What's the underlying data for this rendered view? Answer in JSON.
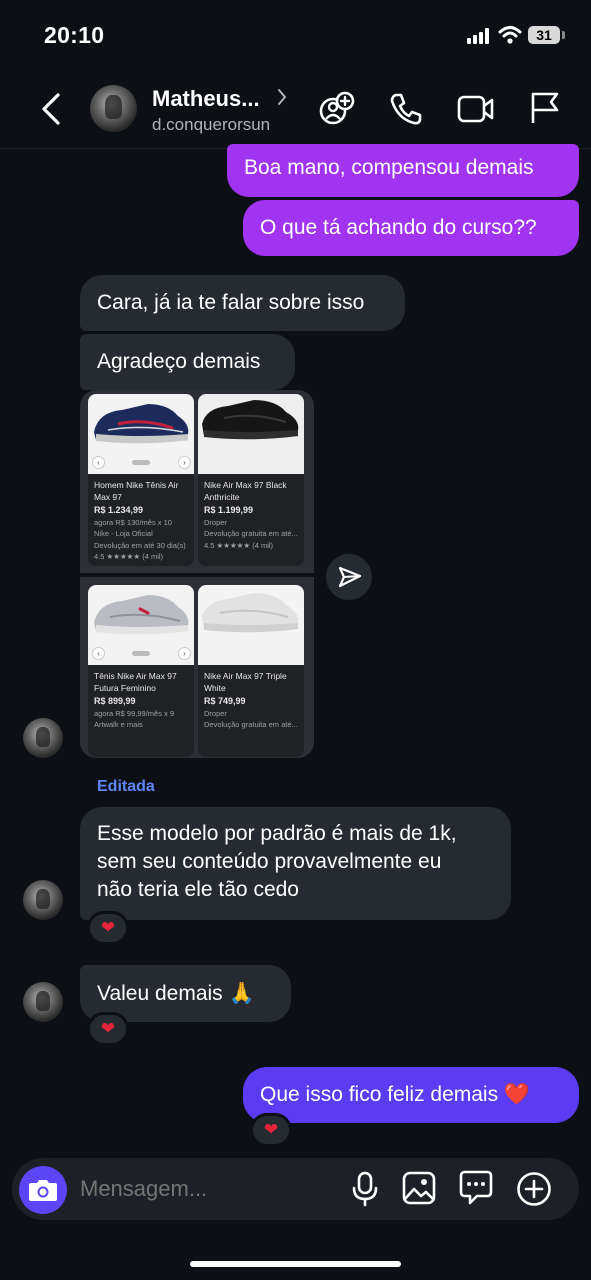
{
  "status_bar": {
    "time": "20:10",
    "battery": "31"
  },
  "header": {
    "contact_name": "Matheus...",
    "username": "d.conquerorsun"
  },
  "messages": {
    "out_1": "Boa mano, compensou demais",
    "out_2": "O que tá achando do curso??",
    "in_1": "Cara, já ia te falar sobre isso",
    "in_2": "Agradeço demais",
    "edited_label": "Editada",
    "in_3_line1": "Esse modelo por padrão é mais de 1k,",
    "in_3_line2": "sem seu conteúdo provavelmente eu",
    "in_3_line3": "não teria ele tão cedo",
    "in_4": "Valeu demais 🙏",
    "out_3": "Que isso fico feliz demais ❤️",
    "reaction": "❤"
  },
  "products": [
    {
      "title": "Homem Nike Tênis Air Max 97",
      "price": "R$ 1.234,99",
      "sub1": "agora R$ 130/mês x 10",
      "sub2": "Nike - Loja Oficial",
      "sub3": "Devolução em até 30 dia(s)",
      "rating": "4.5 ★★★★★ (4 mil)"
    },
    {
      "title": "Nike Air Max 97 Black Anthricite",
      "price": "R$ 1.199,99",
      "sub1": "Droper",
      "sub2": "Devolução gratuita em até...",
      "rating": "4.5 ★★★★★ (4 mil)"
    },
    {
      "title": "Tênis Nike Air Max 97 Futura Feminino",
      "price": "R$ 899,99",
      "sub1": "agora R$ 99,99/mês x 9",
      "sub2": "Artwalk e mais"
    },
    {
      "title": "Nike Air Max 97 Triple White",
      "price": "R$ 749,99",
      "sub1": "Droper",
      "sub2": "Devolução gratuita em até..."
    }
  ],
  "composer": {
    "placeholder": "Mensagem..."
  },
  "colors": {
    "background": "#0c0f14",
    "outgoing_bubble": "#a034f0",
    "outgoing_bubble_last": "#5b3cf2",
    "incoming_bubble": "#262a31",
    "edited_label": "#5e86f5",
    "camera_button": "#5b45f4"
  },
  "icons": {
    "back": "chevron-left-icon",
    "chevron": "chevron-right-icon",
    "add_people": "add-person-icon",
    "call": "phone-icon",
    "video": "video-camera-icon",
    "report": "flag-icon",
    "share": "send-icon",
    "camera": "camera-icon",
    "mic": "microphone-icon",
    "gallery": "image-icon",
    "sticker": "chat-sticker-icon",
    "more": "plus-circle-icon"
  }
}
